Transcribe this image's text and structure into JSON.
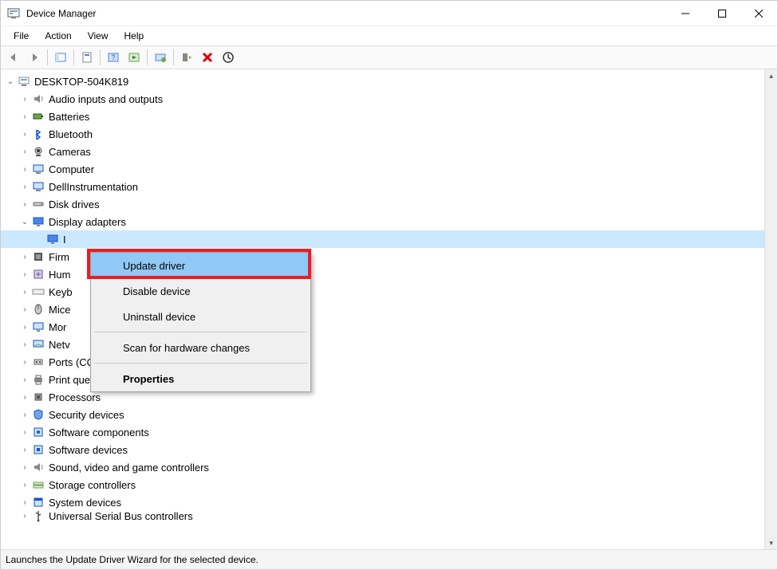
{
  "window": {
    "title": "Device Manager"
  },
  "menus": {
    "file": "File",
    "action": "Action",
    "view": "View",
    "help": "Help"
  },
  "tree": {
    "root": "DESKTOP-504K819",
    "categories": [
      {
        "label": "Audio inputs and outputs",
        "icon": "audio"
      },
      {
        "label": "Batteries",
        "icon": "battery"
      },
      {
        "label": "Bluetooth",
        "icon": "bluetooth"
      },
      {
        "label": "Cameras",
        "icon": "camera"
      },
      {
        "label": "Computer",
        "icon": "computer"
      },
      {
        "label": "DellInstrumentation",
        "icon": "dell"
      },
      {
        "label": "Disk drives",
        "icon": "disk"
      },
      {
        "label": "Display adapters",
        "icon": "display",
        "expanded": true
      },
      {
        "label": "Firm",
        "icon": "firmware",
        "truncated": true
      },
      {
        "label": "Hum",
        "icon": "hid",
        "truncated": true
      },
      {
        "label": "Keyb",
        "icon": "keyboard",
        "truncated": true
      },
      {
        "label": "Mice",
        "icon": "mouse",
        "truncated": true
      },
      {
        "label": "Mor",
        "icon": "monitor",
        "truncated": true
      },
      {
        "label": "Netv",
        "icon": "network",
        "truncated": true
      },
      {
        "label": "Ports (COM & LPT)",
        "icon": "ports"
      },
      {
        "label": "Print queues",
        "icon": "printer"
      },
      {
        "label": "Processors",
        "icon": "cpu"
      },
      {
        "label": "Security devices",
        "icon": "security"
      },
      {
        "label": "Software components",
        "icon": "sw-comp"
      },
      {
        "label": "Software devices",
        "icon": "sw-dev"
      },
      {
        "label": "Sound, video and game controllers",
        "icon": "audio"
      },
      {
        "label": "Storage controllers",
        "icon": "storage"
      },
      {
        "label": "System devices",
        "icon": "system"
      },
      {
        "label": "Universal Serial Bus controllers",
        "icon": "usb",
        "cutoff": true
      }
    ],
    "display_child": "I"
  },
  "context_menu": {
    "items": [
      {
        "label": "Update driver",
        "highlighted": true
      },
      {
        "label": "Disable device"
      },
      {
        "label": "Uninstall device"
      },
      {
        "sep": true
      },
      {
        "label": "Scan for hardware changes"
      },
      {
        "sep": true
      },
      {
        "label": "Properties",
        "bold": true
      }
    ]
  },
  "statusbar": {
    "text": "Launches the Update Driver Wizard for the selected device."
  }
}
